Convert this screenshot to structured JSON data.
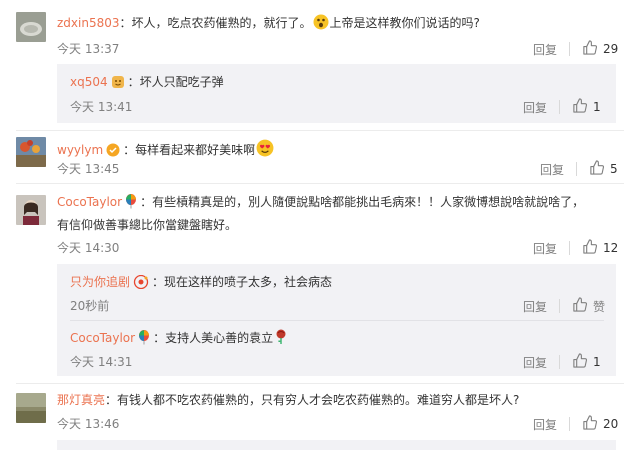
{
  "reply_label": "回复",
  "comments": [
    {
      "user": "zdxin5803",
      "text_a": "坏人，吃点农药催熟的，就行了。",
      "text_b": "上帝是这样教你们说话的吗?",
      "time": "今天 13:37",
      "likes": "29"
    },
    {
      "user": "wyylym",
      "text_a": "每样看起来都好美味啊",
      "time": "今天 13:45",
      "likes": "5"
    },
    {
      "user": "CocoTaylor",
      "text_a": "有些槓精真是的，別人隨便說點啥都能挑出毛病來！！人家微博想說啥就說啥了，",
      "text_b": "有信仰做善事總比你當鍵盤瞎好。",
      "time": "今天 14:30",
      "likes": "12"
    },
    {
      "user": "那灯真亮",
      "text_a": "有钱人都不吃农药催熟的，只有穷人才会吃农药催熟的。难道穷人都是坏人?",
      "time": "今天 13:46",
      "likes": "20"
    }
  ],
  "replies": [
    {
      "user": "xq504",
      "text": "坏人只配吃子弹",
      "time": "今天 13:41",
      "likes": "1"
    },
    {
      "user": "只为你追剧",
      "text": "现在这样的喷子太多，社会病态",
      "time": "20秒前",
      "likes": "赞"
    },
    {
      "user": "CocoTaylor",
      "text": "支持人美心善的袁立",
      "time": "今天 14:31",
      "likes": "1"
    }
  ],
  "colors": {
    "username": "#eb7350",
    "meta": "#808080",
    "reply_bg": "#f2f2f5"
  },
  "icons": [
    "thumbs-up-icon",
    "smiley-emoji",
    "heart-eyes-emoji",
    "rose-emoji",
    "vip-badge-icon"
  ]
}
